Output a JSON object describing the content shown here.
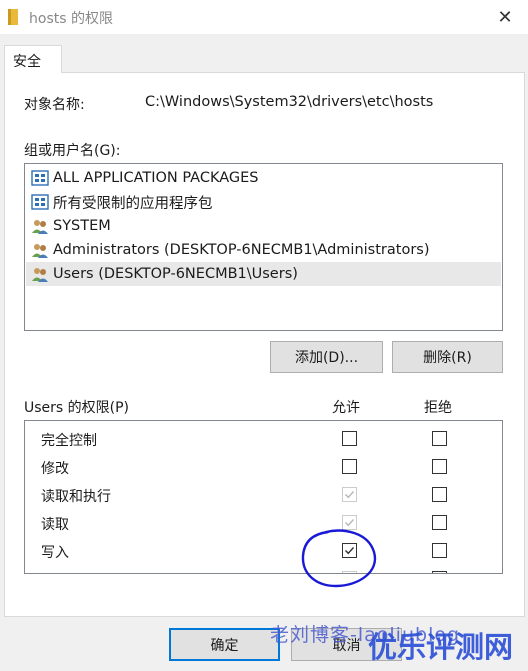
{
  "window": {
    "title": "hosts 的权限",
    "close_glyph": "✕"
  },
  "tabs": [
    {
      "label": "安全"
    }
  ],
  "object": {
    "label": "对象名称:",
    "value": "C:\\Windows\\System32\\drivers\\etc\\hosts"
  },
  "groups": {
    "label": "组或用户名(G):",
    "items": [
      {
        "label": "ALL APPLICATION PACKAGES",
        "icon": "app-packages-icon"
      },
      {
        "label": "所有受限制的应用程序包",
        "icon": "app-packages-icon"
      },
      {
        "label": "SYSTEM",
        "icon": "users-icon"
      },
      {
        "label": "Administrators (DESKTOP-6NECMB1\\Administrators)",
        "icon": "users-icon"
      },
      {
        "label": "Users (DESKTOP-6NECMB1\\Users)",
        "icon": "users-icon",
        "selected": true
      }
    ],
    "add_label": "添加(D)...",
    "remove_label": "删除(R)"
  },
  "permissions": {
    "label": "Users 的权限(P)",
    "allow_header": "允许",
    "deny_header": "拒绝",
    "rows": [
      {
        "name": "完全控制",
        "allow": false,
        "allow_disabled": false,
        "deny": false
      },
      {
        "name": "修改",
        "allow": false,
        "allow_disabled": false,
        "deny": false
      },
      {
        "name": "读取和执行",
        "allow": true,
        "allow_disabled": true,
        "deny": false
      },
      {
        "name": "读取",
        "allow": true,
        "allow_disabled": true,
        "deny": false
      },
      {
        "name": "写入",
        "allow": true,
        "allow_disabled": false,
        "deny": false
      }
    ]
  },
  "buttons": {
    "ok": "确定",
    "cancel": "取消"
  },
  "watermarks": {
    "left": "老刘博客-laoliublog",
    "right": "优乐评测网"
  },
  "colors": {
    "accent": "#0078d7",
    "annotation_circle": "#1a1ad6"
  }
}
